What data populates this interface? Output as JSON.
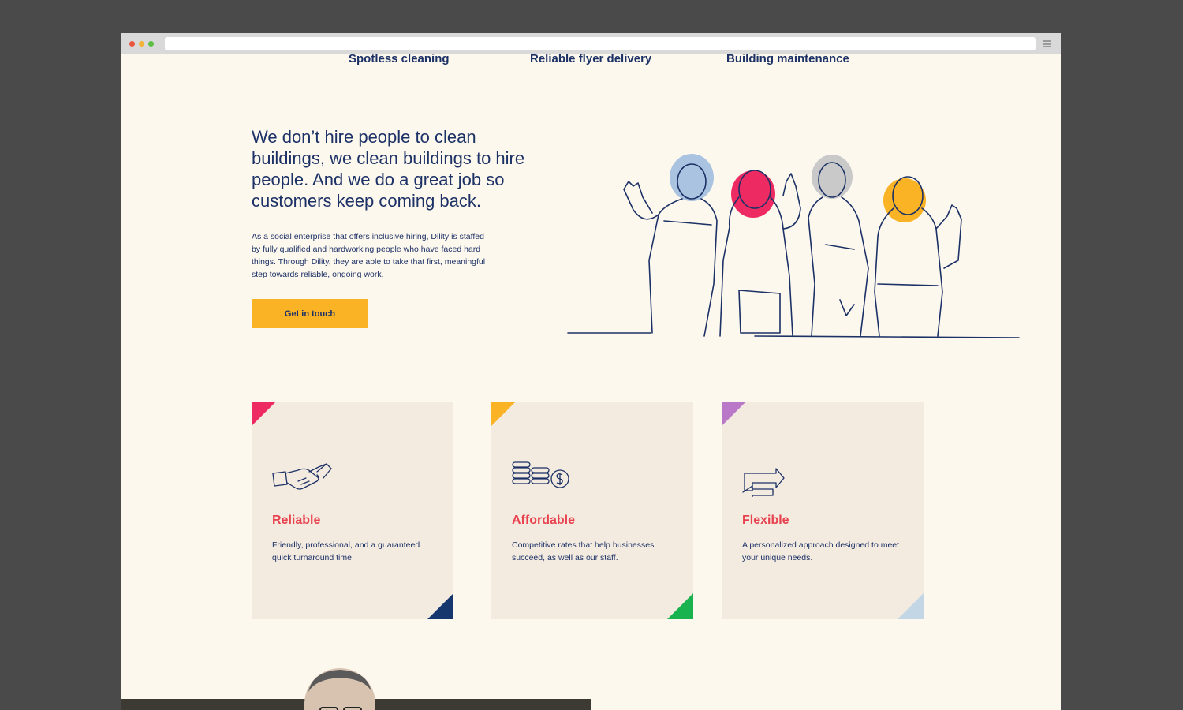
{
  "browser": {
    "window_controls": [
      "close",
      "minimize",
      "maximize"
    ],
    "menu_icon": "hamburger-icon"
  },
  "services": {
    "items": [
      {
        "label": "Spotless cleaning"
      },
      {
        "label": "Reliable flyer delivery"
      },
      {
        "label": "Building maintenance"
      }
    ]
  },
  "hero": {
    "headline": "We don’t hire people to clean buildings, we clean buildings to hire people. And we do a great job so customers keep coming back.",
    "body": "As a social enterprise that offers inclusive hiring, Dility is staffed by fully qualified and hardworking people who have faced hard things. Through Dility, they are able to take that first, meaningful step towards reliable, ongoing work.",
    "cta_label": "Get in touch",
    "illustration": "line-art-team-of-workers",
    "accent_colors": {
      "blue": "#a9c3e0",
      "pink": "#ee2a63",
      "gray": "#c9c9c9",
      "yellow": "#fbb326"
    }
  },
  "features": [
    {
      "icon": "handshake-icon",
      "title": "Reliable",
      "text": "Friendly, professional, and a guaranteed quick turnaround time.",
      "corner_top": "#ee2a63",
      "corner_bottom": "#16366e"
    },
    {
      "icon": "coins-icon",
      "title": "Affordable",
      "text": "Competitive rates that help businesses succeed, as well as our staff.",
      "corner_top": "#fbb326",
      "corner_bottom": "#18b24f"
    },
    {
      "icon": "arrows-exchange-icon",
      "title": "Flexible",
      "text": "A personalized approach designed to meet your unique needs.",
      "corner_top": "#b978c8",
      "corner_bottom": "#c3d6e6"
    }
  ]
}
